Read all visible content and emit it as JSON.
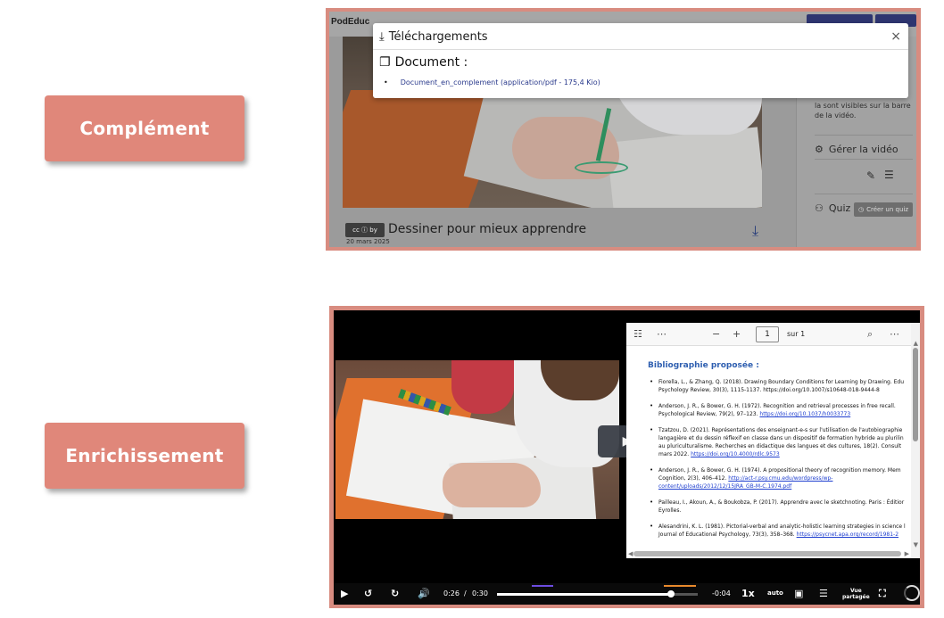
{
  "badges": {
    "top": "Complément",
    "bottom": "Enrichissement"
  },
  "shot1": {
    "logo": "PodEduc",
    "modal": {
      "title": "Téléchargements",
      "close": "×",
      "section": "Document :",
      "file_name": "Document_en_complement",
      "file_meta": "(application/pdf - 175,4 Kio)"
    },
    "sidebar": {
      "hint": "la sont visibles sur la barre de la vidéo.",
      "manage_label": "Gérer la vidéo",
      "quiz_label": "Quiz",
      "quiz_button": "Créer un quiz"
    },
    "video_title": "Dessiner pour mieux apprendre",
    "date": "20 mars 2025",
    "cc_text": "cc ⓘ by"
  },
  "shot2": {
    "pdf": {
      "page_number": "1",
      "page_total": "sur 1",
      "heading": "Bibliographie proposée :",
      "references": [
        {
          "text": "Fiorella, L., & Zhang, Q. (2018). Drawing Boundary Conditions for Learning by Drawing. Edu",
          "line2": "Psychology Review, 30(3), 1115-1137. https://doi.org/10.1007/s10648-018-9444-8",
          "link": ""
        },
        {
          "text": "Anderson, J. R., & Bower, G. H. (1972). Recognition and retrieval processes in free recall.",
          "line2": "Psychological Review, 79(2), 97–123. ",
          "link": "https://doi.org/10.1037/h0033773"
        },
        {
          "text": "Tzatzou, D. (2021). Représentations des enseignant-e-s sur l'utilisation de l'autobiographie",
          "line2": "langagière et du dessin réflexif en classe dans un dispositif de formation hybride au plurilin",
          "line3": "au pluriculturalisme. Recherches en didactique des langues et des cultures, 18(2). Consult",
          "line4": "mars 2022. ",
          "link": "https://doi.org/10.4000/rdlc.9573"
        },
        {
          "text": "Anderson, J. R., & Bower, G. H. (1974). A propositional theory of recognition memory. Mem",
          "line2": "Cognition, 2(3), 406–412. ",
          "link": "http://act-r.psy.cmu.edu/wordpress/wp-",
          "line3link": "content/uploads/2012/12/15JRA_GB-M-C.1974.pdf"
        },
        {
          "text": "Pailleau, I., Akoun, A., & Boukobza, P. (2017). Apprendre avec le sketchnoting. Paris : Éditior",
          "line2": "Eyrolles.",
          "link": ""
        },
        {
          "text": "Alesandrini, K. L. (1981). Pictorial-verbal and analytic-holistic learning strategies in science l",
          "line2": "Journal of Educational Psychology, 73(3), 358–368. ",
          "link": "https://psycnet.apa.org/record/1981-2"
        }
      ]
    },
    "controls": {
      "current_time": "0:26",
      "separator": "/",
      "duration": "0:30",
      "remaining": "-0:04",
      "speed": "1x",
      "quality": "auto",
      "shared_view_line1": "Vue",
      "shared_view_line2": "partagée",
      "progress_fraction": 0.867
    }
  }
}
